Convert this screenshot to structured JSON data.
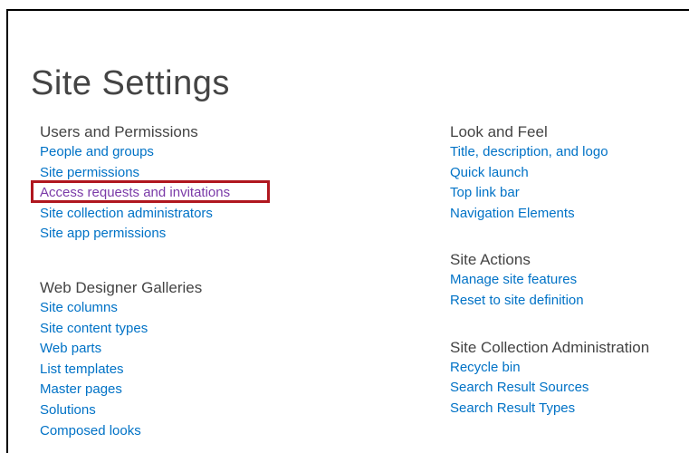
{
  "page_title": "Site Settings",
  "left_column": [
    {
      "heading": "Users and Permissions",
      "links": [
        {
          "label": "People and groups"
        },
        {
          "label": "Site permissions"
        },
        {
          "label": "Access requests and invitations",
          "visited": true,
          "highlighted": true
        },
        {
          "label": "Site collection administrators"
        },
        {
          "label": "Site app permissions"
        }
      ]
    },
    {
      "heading": "Web Designer Galleries",
      "links": [
        {
          "label": "Site columns"
        },
        {
          "label": "Site content types"
        },
        {
          "label": "Web parts"
        },
        {
          "label": "List templates"
        },
        {
          "label": "Master pages"
        },
        {
          "label": "Solutions"
        },
        {
          "label": "Composed looks"
        }
      ]
    }
  ],
  "right_column": [
    {
      "heading": "Look and Feel",
      "links": [
        {
          "label": "Title, description, and logo"
        },
        {
          "label": "Quick launch"
        },
        {
          "label": "Top link bar"
        },
        {
          "label": "Navigation Elements"
        }
      ]
    },
    {
      "heading": "Site Actions",
      "links": [
        {
          "label": "Manage site features"
        },
        {
          "label": "Reset to site definition"
        }
      ]
    },
    {
      "heading": "Site Collection Administration",
      "links": [
        {
          "label": "Recycle bin"
        },
        {
          "label": "Search Result Sources"
        },
        {
          "label": "Search Result Types"
        }
      ]
    }
  ],
  "colors": {
    "link": "#0072c6",
    "visited_link": "#7a3aa8",
    "heading": "#444444",
    "highlight_border": "#b0171f"
  }
}
